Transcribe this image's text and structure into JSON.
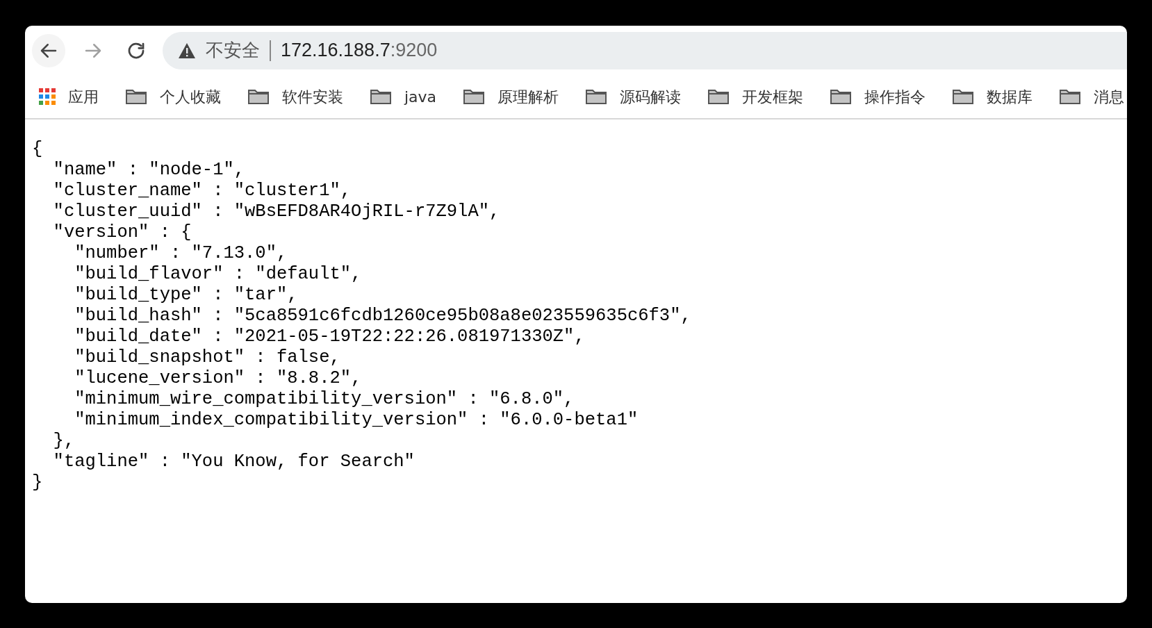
{
  "toolbar": {
    "back": {
      "disabled": false
    },
    "forward": {
      "disabled": true
    },
    "security_label": "不安全",
    "url_host": "172.16.188.7",
    "url_port": ":9200"
  },
  "bookmarks": [
    {
      "kind": "apps",
      "label": "应用"
    },
    {
      "kind": "folder",
      "label": "个人收藏"
    },
    {
      "kind": "folder",
      "label": "软件安装"
    },
    {
      "kind": "folder",
      "label": "java"
    },
    {
      "kind": "folder",
      "label": "原理解析"
    },
    {
      "kind": "folder",
      "label": "源码解读"
    },
    {
      "kind": "folder",
      "label": "开发框架"
    },
    {
      "kind": "folder",
      "label": "操作指令"
    },
    {
      "kind": "folder",
      "label": "数据库"
    },
    {
      "kind": "folder",
      "label": "消息"
    }
  ],
  "content_lines": [
    "{",
    "  \"name\" : \"node-1\",",
    "  \"cluster_name\" : \"cluster1\",",
    "  \"cluster_uuid\" : \"wBsEFD8AR4OjRIL-r7Z9lA\",",
    "  \"version\" : {",
    "    \"number\" : \"7.13.0\",",
    "    \"build_flavor\" : \"default\",",
    "    \"build_type\" : \"tar\",",
    "    \"build_hash\" : \"5ca8591c6fcdb1260ce95b08a8e023559635c6f3\",",
    "    \"build_date\" : \"2021-05-19T22:22:26.081971330Z\",",
    "    \"build_snapshot\" : false,",
    "    \"lucene_version\" : \"8.8.2\",",
    "    \"minimum_wire_compatibility_version\" : \"6.8.0\",",
    "    \"minimum_index_compatibility_version\" : \"6.0.0-beta1\"",
    "  },",
    "  \"tagline\" : \"You Know, for Search\"",
    "}"
  ]
}
